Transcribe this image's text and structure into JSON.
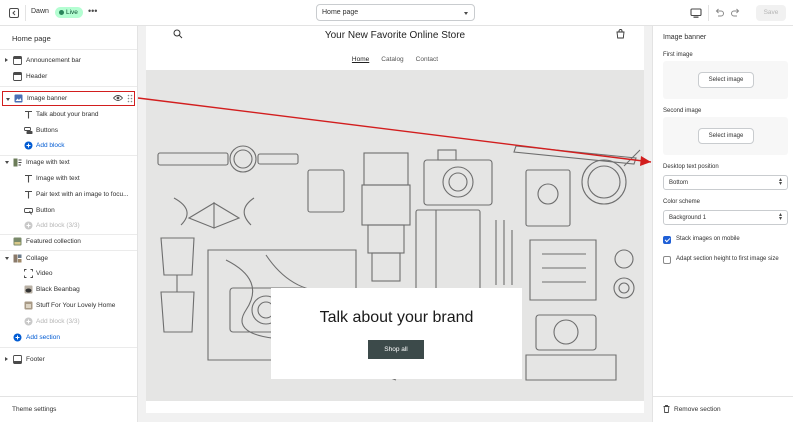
{
  "topbar": {
    "theme_name": "Dawn",
    "live_badge": "Live",
    "more_label": "•••",
    "page_select": "Home page",
    "save_label": "Save"
  },
  "sidebar": {
    "title": "Home page",
    "items": {
      "announcement": "Announcement bar",
      "header": "Header",
      "image_banner": "Image banner",
      "talk_brand": "Talk about your brand",
      "buttons": "Buttons",
      "add_block_1": "Add block",
      "image_with_text": "Image with text",
      "iwt_image": "Image with text",
      "iwt_pair": "Pair text with an image to focu...",
      "iwt_button": "Button",
      "add_block_2": "Add block (3/3)",
      "featured": "Featured collection",
      "collage": "Collage",
      "video": "Video",
      "black_beanbag": "Black Beanbag",
      "stuff": "Stuff For Your Lovely Home",
      "add_block_3": "Add block (3/3)",
      "add_section": "Add section",
      "footer": "Footer"
    },
    "theme_settings": "Theme settings"
  },
  "store": {
    "name": "Your New Favorite Online Store",
    "nav": [
      "Home",
      "Catalog",
      "Contact"
    ],
    "banner_heading": "Talk about your brand",
    "shop_button": "Shop all"
  },
  "settings": {
    "title": "Image banner",
    "first_image_label": "First image",
    "first_image_button": "Select image",
    "second_image_label": "Second image",
    "second_image_button": "Select image",
    "text_position_label": "Desktop text position",
    "text_position_value": "Bottom",
    "color_scheme_label": "Color scheme",
    "color_scheme_value": "Background 1",
    "stack_images_label": "Stack images on mobile",
    "stack_images_checked": true,
    "adapt_height_label": "Adapt section height to first image size",
    "adapt_height_checked": false,
    "remove_label": "Remove section"
  },
  "colors": {
    "accent_blue": "#005bd3",
    "annotation_red": "#d21e1e",
    "live_badge_bg": "#b4fed2",
    "shop_button_bg": "#3c4a4a"
  }
}
